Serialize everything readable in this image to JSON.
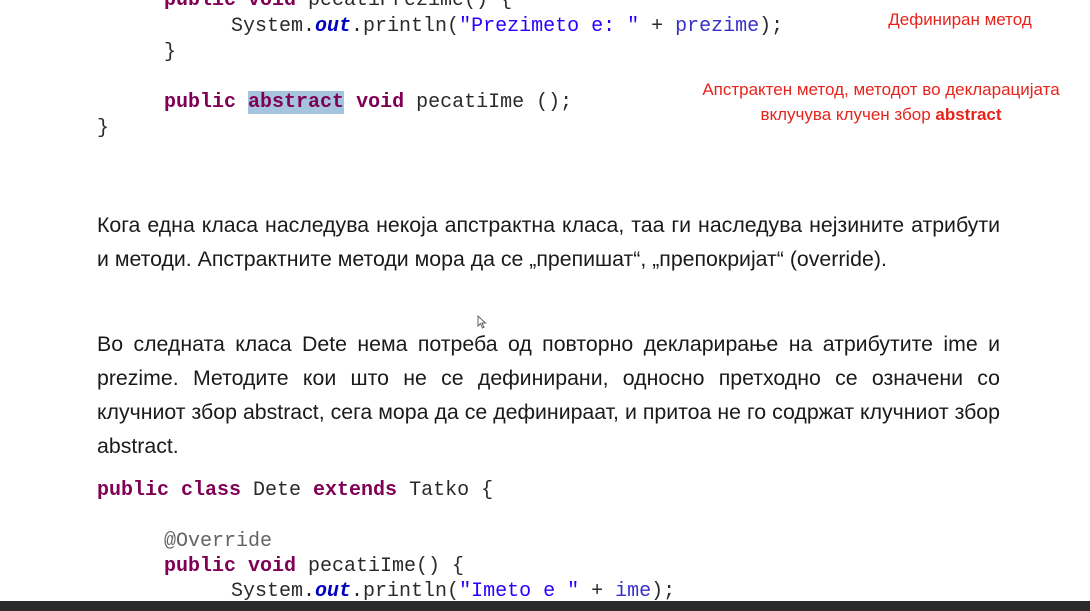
{
  "code_top": {
    "line1_kw": "public void",
    "line1_name": " pecatiPrezime() {",
    "line2_pre": "System.",
    "line2_field": "out",
    "line2_mid": ".println(",
    "line2_str": "\"Prezimeto e: \"",
    "line2_plus": " + ",
    "line2_var": "prezime",
    "line2_end": ");",
    "line3": "}",
    "line4_kw1": "public",
    "line4_kw2": "abstract",
    "line4_kw3": "void",
    "line4_name": " pecatiIme ();",
    "line5": "}"
  },
  "notes": {
    "defined_method": "Дефиниран метод",
    "abstract_line1": "Апстрактен метод, методот во декларацијата",
    "abstract_line2_pre": "вклучува клучен збор ",
    "abstract_line2_bold": "abstract"
  },
  "paragraphs": {
    "p1": "Кога една класа наследува некоја апстрактна класа, таа ги наследува нејзините атрибути и методи. Апстрактните методи мора да се „препишат“, „препокријат“ (override).",
    "p2": "Во следната класа Dete нема потреба од повторно декларирање на атрибутите ime и prezime. Методите кои што не се дефинирани, односно претходно се означени со клучниот збор abstract, сега мора да се дефинираат, и притоа не го содржат клучниот збор abstract."
  },
  "code_bottom": {
    "line1_kw1": "public class",
    "line1_name": " Dete ",
    "line1_kw2": "extends",
    "line1_rest": " Tatko {",
    "line2_ann": "@Override",
    "line3_kw": "public void",
    "line3_name": " pecatiIme() {",
    "line4_pre": "System.",
    "line4_field": "out",
    "line4_mid": ".println(",
    "line4_str": "\"Imeto e \"",
    "line4_plus": " + ",
    "line4_var": "ime",
    "line4_end": ");"
  },
  "colors": {
    "keyword": "#7f0055",
    "string": "#2a00ff",
    "field": "#0000c0",
    "annotation_note": "#e8231c",
    "highlight": "#a7c4df"
  },
  "icons": {
    "cursor": "mouse-pointer-icon"
  }
}
